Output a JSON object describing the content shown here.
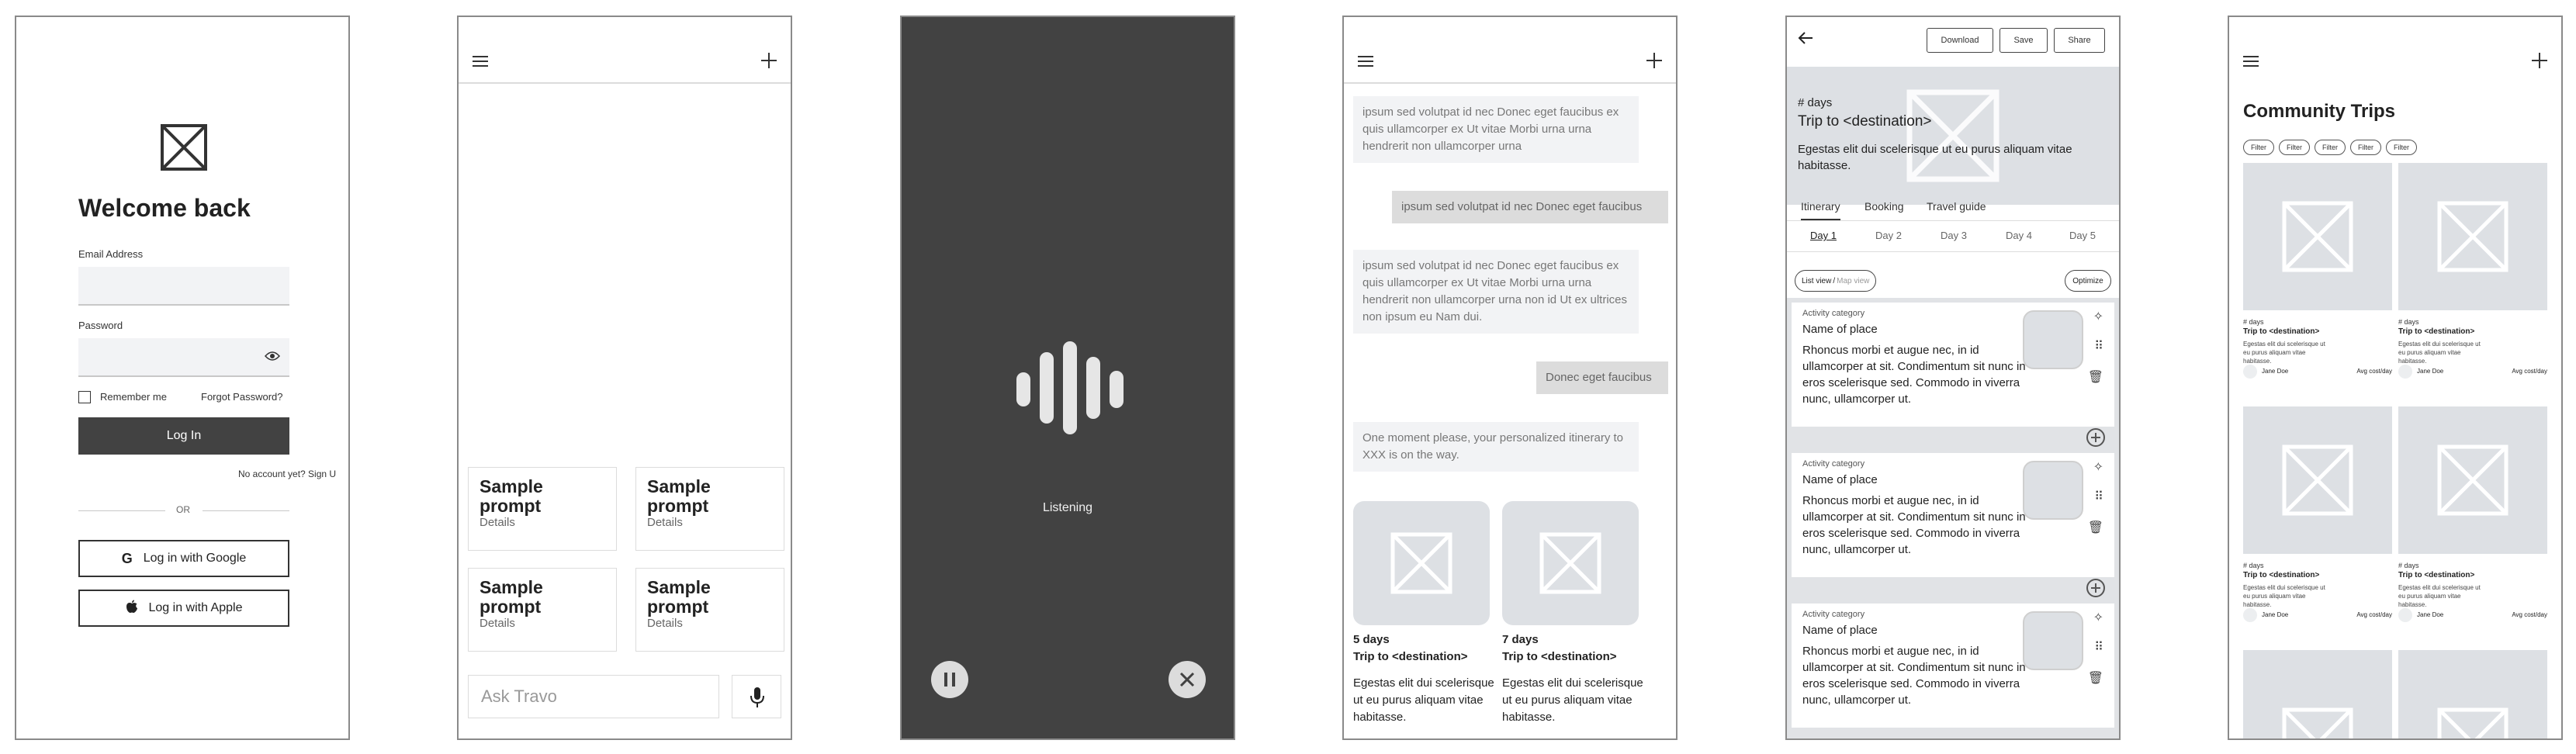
{
  "login": {
    "title": "Welcome back",
    "email_label": "Email Address",
    "password_label": "Password",
    "remember_label": "Remember me",
    "forgot_label": "Forgot Password?",
    "login_button": "Log In",
    "signup_text": "No account yet? Sign U",
    "or_text": "OR",
    "google_button": "Log in with Google",
    "apple_button": "Log in with Apple"
  },
  "home": {
    "prompts": [
      {
        "title": "Sample prompt",
        "details": "Details"
      },
      {
        "title": "Sample prompt",
        "details": "Details"
      },
      {
        "title": "Sample prompt",
        "details": "Details"
      },
      {
        "title": "Sample prompt",
        "details": "Details"
      }
    ],
    "input_placeholder": "Ask Travo"
  },
  "voice": {
    "status": "Listening"
  },
  "chat": {
    "messages": [
      {
        "role": "bot",
        "text": "ipsum sed volutpat id nec Donec eget faucibus ex quis ullamcorper ex Ut vitae Morbi urna urna hendrerit non ullamcorper urna"
      },
      {
        "role": "user",
        "text": "ipsum sed volutpat id nec Donec eget faucibus"
      },
      {
        "role": "bot",
        "text": "ipsum sed volutpat id nec Donec eget faucibus ex quis ullamcorper ex Ut vitae Morbi urna urna hendrerit non ullamcorper urna non id Ut ex ultrices non ipsum eu Nam dui."
      },
      {
        "role": "user",
        "text": "Donec eget faucibus"
      },
      {
        "role": "bot",
        "text": "One moment please, your personalized itinerary to XXX is on the way."
      }
    ],
    "trips": [
      {
        "days": "5 days",
        "title": "Trip to <destination>",
        "desc": "Egestas elit dui scelerisque ut eu purus aliquam vitae habitasse."
      },
      {
        "days": "7 days",
        "title": "Trip to <destination>",
        "desc": "Egestas elit dui scelerisque ut eu purus aliquam vitae habitasse."
      }
    ]
  },
  "itinerary": {
    "toolbar": {
      "download": "Download",
      "save": "Save",
      "share": "Share"
    },
    "hero": {
      "days": "# days",
      "title": "Trip to <destination>",
      "desc": "Egestas elit dui scelerisque ut eu purus aliquam vitae habitasse."
    },
    "tabs": [
      "Itinerary",
      "Booking",
      "Travel guide"
    ],
    "days": [
      "Day 1",
      "Day 2",
      "Day 3",
      "Day 4",
      "Day 5"
    ],
    "view_toggle": {
      "list": "List view",
      "sep": "/",
      "map": "Map view"
    },
    "optimize": "Optimize",
    "activities": [
      {
        "category": "Activity category",
        "name": "Name of place",
        "desc": "Rhoncus morbi et augue nec, in id ullamcorper at sit. Condimentum sit nunc in eros scelerisque sed. Commodo in viverra nunc, ullamcorper ut."
      },
      {
        "category": "Activity category",
        "name": "Name of place",
        "desc": "Rhoncus morbi et augue nec, in id ullamcorper at sit. Condimentum sit nunc in eros scelerisque sed. Commodo in viverra nunc, ullamcorper ut."
      },
      {
        "category": "Activity category",
        "name": "Name of place",
        "desc": "Rhoncus morbi et augue nec, in id ullamcorper at sit. Condimentum sit nunc in eros scelerisque sed. Commodo in viverra nunc, ullamcorper ut."
      }
    ]
  },
  "community": {
    "title": "Community Trips",
    "filters": [
      "Filter",
      "Filter",
      "Filter",
      "Filter",
      "Filter"
    ],
    "cards": [
      {
        "days": "# days",
        "title": "Trip to <destination>",
        "desc": "Egestas elit dui scelerisque ut eu purus aliquam vitae habitasse.",
        "author": "Jane Doe",
        "cost": "Avg cost/day"
      },
      {
        "days": "# days",
        "title": "Trip to <destination>",
        "desc": "Egestas elit dui scelerisque ut eu purus aliquam vitae habitasse.",
        "author": "Jane Doe",
        "cost": "Avg cost/day"
      },
      {
        "days": "# days",
        "title": "Trip to <destination>",
        "desc": "Egestas elit dui scelerisque ut eu purus aliquam vitae habitasse.",
        "author": "Jane Doe",
        "cost": "Avg cost/day"
      },
      {
        "days": "# days",
        "title": "Trip to <destination>",
        "desc": "Egestas elit dui scelerisque ut eu purus aliquam vitae habitasse.",
        "author": "Jane Doe",
        "cost": "Avg cost/day"
      }
    ]
  }
}
